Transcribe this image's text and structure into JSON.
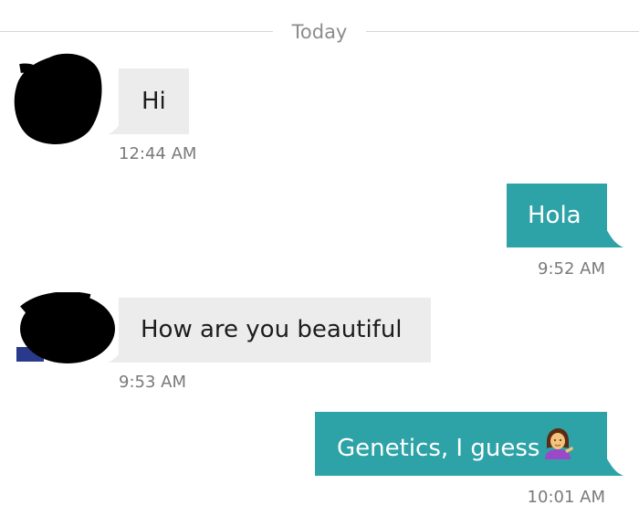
{
  "divider": {
    "label": "Today"
  },
  "colors": {
    "incoming_bubble": "#ececec",
    "outgoing_bubble": "#2ea3a7",
    "timestamp": "#7a7a7a",
    "divider_text": "#8c8c8c"
  },
  "messages": [
    {
      "direction": "incoming",
      "text": "Hi",
      "time": "12:44 AM"
    },
    {
      "direction": "outgoing",
      "text": "Hola",
      "time": "9:52 AM"
    },
    {
      "direction": "incoming",
      "text": "How are you beautiful",
      "time": "9:53 AM"
    },
    {
      "direction": "outgoing",
      "text": "Genetics, I guess",
      "emoji": "person-tipping-hand-emoji",
      "time": "10:01 AM"
    }
  ]
}
